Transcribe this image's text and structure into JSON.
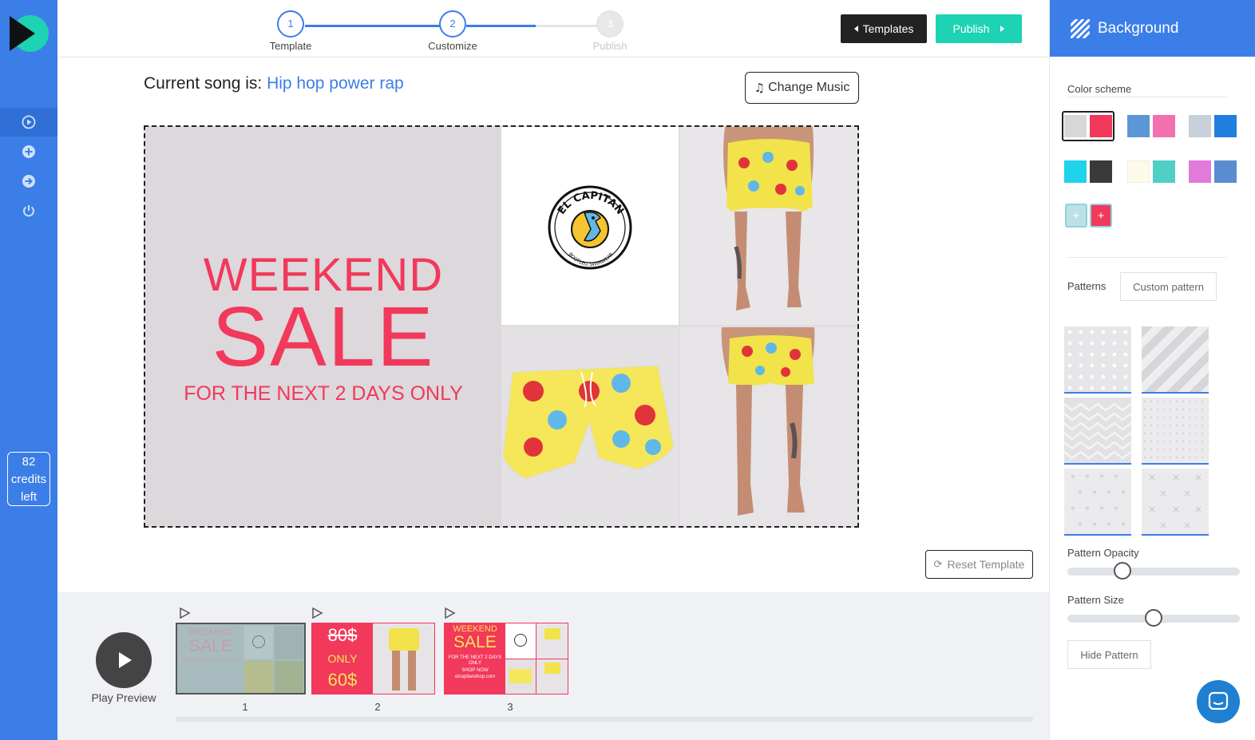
{
  "stepper": {
    "steps": [
      {
        "number": "1",
        "label": "Template"
      },
      {
        "number": "2",
        "label": "Customize"
      },
      {
        "number": "3",
        "label": "Publish"
      }
    ]
  },
  "toolbar": {
    "templates_label": "Templates",
    "publish_label": "Publish"
  },
  "song": {
    "prefix": "Current song is:",
    "name": "Hip hop power rap",
    "change_label": "Change Music"
  },
  "sidebar": {
    "credits_count": "82",
    "credits_word1": "credits",
    "credits_word2": "left"
  },
  "canvas": {
    "headline": "WEEKEND",
    "big": "SALE",
    "sub": "FOR THE NEXT 2 DAYS ONLY",
    "logo_text_top": "EL CAPITAN",
    "logo_text_bottom": "BOOTLEG SWIMWEAR"
  },
  "reset_label": "Reset Template",
  "timeline": {
    "play_label": "Play Preview",
    "slides": [
      {
        "number": "1",
        "line1": "WEEKEND",
        "line2": "SALE",
        "line3": "FOR THE NEXT 2 DAYS ONLY"
      },
      {
        "number": "2",
        "line1": "80$",
        "line2": "ONLY",
        "line3": "60$"
      },
      {
        "number": "3",
        "line1": "WEEKEND",
        "line2": "SALE",
        "line3": "FOR THE NEXT 2 DAYS ONLY",
        "line4": "SHOP NOW",
        "line5": "elcapitanshop.com"
      }
    ]
  },
  "panel": {
    "title": "Background",
    "color_scheme_label": "Color scheme",
    "patterns_label": "Patterns",
    "custom_pattern_label": "Custom pattern",
    "opacity_label": "Pattern Opacity",
    "opacity_value": 0.3,
    "size_label": "Pattern Size",
    "size_value": 0.5,
    "hide_pattern_label": "Hide Pattern",
    "schemes": [
      [
        "#d9d6da",
        "#f2385b"
      ],
      [
        "#5e97d6",
        "#f26fb0"
      ],
      [
        "#c8d0da",
        "#1f7fe0"
      ],
      [
        "#1fd3ea",
        "#3a3a3a"
      ],
      [
        "#fdfae8",
        "#4fcfc6"
      ],
      [
        "#e07adb",
        "#5a8ccf"
      ]
    ],
    "plus_colors": [
      "#bde0e6",
      "#f2385b"
    ]
  },
  "colors": {
    "accent": "#3b7ee8",
    "brand_pink": "#f2385b",
    "publish": "#1dd3b3"
  }
}
